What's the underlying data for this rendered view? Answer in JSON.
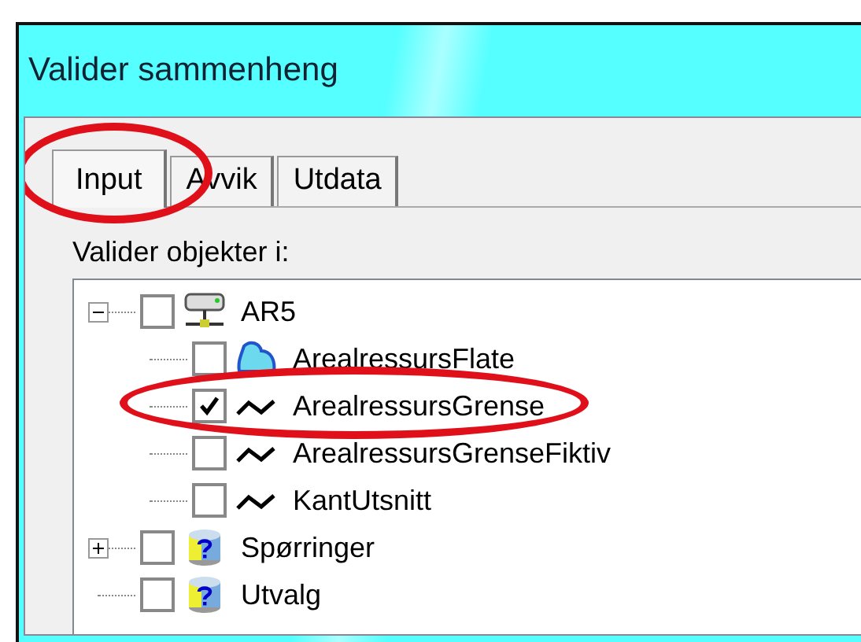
{
  "window": {
    "title": "Valider sammenheng"
  },
  "tabs": [
    {
      "label": "Input",
      "selected": true,
      "highlighted": true
    },
    {
      "label": "Avvik",
      "selected": false
    },
    {
      "label": "Utdata",
      "selected": false
    }
  ],
  "tree_label": "Valider objekter i:",
  "tree": [
    {
      "label": "AR5",
      "kind": "server",
      "checked": false,
      "expanded": true,
      "children": [
        {
          "label": "ArealressursFlate",
          "kind": "polygon",
          "checked": false
        },
        {
          "label": "ArealressursGrense",
          "kind": "line",
          "checked": true,
          "highlighted": true
        },
        {
          "label": "ArealressursGrenseFiktiv",
          "kind": "line",
          "checked": false
        },
        {
          "label": "KantUtsnitt",
          "kind": "line",
          "checked": false
        }
      ]
    },
    {
      "label": "Spørringer",
      "kind": "query",
      "checked": false,
      "expanded": false
    },
    {
      "label": "Utvalg",
      "kind": "query",
      "checked": false
    }
  ]
}
